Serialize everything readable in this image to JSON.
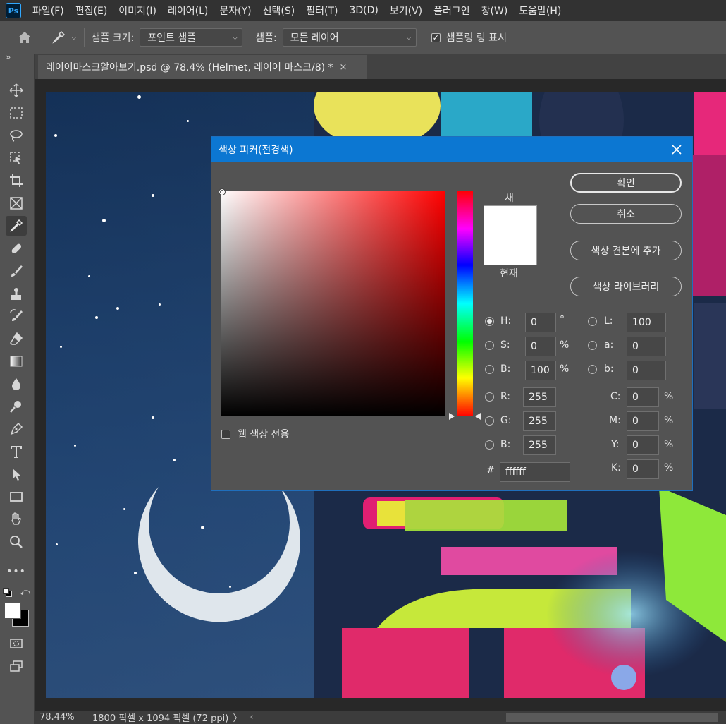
{
  "menubar": {
    "logo": "Ps",
    "items": [
      "파일(F)",
      "편집(E)",
      "이미지(I)",
      "레이어(L)",
      "문자(Y)",
      "선택(S)",
      "필터(T)",
      "3D(D)",
      "보기(V)",
      "플러그인",
      "창(W)",
      "도움말(H)"
    ]
  },
  "options": {
    "sample_size_label": "샘플 크기:",
    "sample_size_value": "포인트 샘플",
    "sample_label": "샘플:",
    "sample_value": "모든 레이어",
    "show_ring_label": "샘플링 링 표시",
    "show_ring_checked": true
  },
  "document_tab": {
    "title": "레이어마스크알아보기.psd @ 78.4% (Helmet, 레이어 마스크/8) *",
    "close": "×"
  },
  "toolbar": {
    "collapse": "»",
    "tools": [
      "move-tool",
      "marquee-tool",
      "lasso-tool",
      "object-select-tool",
      "crop-tool",
      "frame-tool",
      "eyedropper-tool",
      "healing-tool",
      "brush-tool",
      "stamp-tool",
      "history-brush-tool",
      "eraser-tool",
      "gradient-tool",
      "blur-tool",
      "dodge-tool",
      "pen-tool",
      "type-tool",
      "path-select-tool",
      "rectangle-tool",
      "hand-tool",
      "zoom-tool",
      "more-tools"
    ],
    "active_tool": "eyedropper-tool",
    "more": "•••",
    "foreground_color": "#ffffff",
    "background_color": "#000000"
  },
  "status": {
    "zoom": "78.44%",
    "doc_info": "1800 픽셀 x 1094 픽셀 (72 ppi)",
    "arrow": "〉",
    "scroll_left": "‹"
  },
  "color_picker": {
    "title": "색상 피커(전경색)",
    "new_label": "새",
    "current_label": "현재",
    "new_color": "#ffffff",
    "current_color": "#ffffff",
    "web_colors_label": "웹 색상 전용",
    "web_colors_checked": false,
    "buttons": {
      "ok": "확인",
      "cancel": "취소",
      "add_to_swatches": "색상 견본에 추가",
      "color_libraries": "색상 라이브러리"
    },
    "hsb": {
      "h_label": "H:",
      "h_value": "0",
      "h_unit": "°",
      "s_label": "S:",
      "s_value": "0",
      "s_unit": "%",
      "b_label": "B:",
      "b_value": "100",
      "b_unit": "%"
    },
    "lab": {
      "l_label": "L:",
      "l_value": "100",
      "a_label": "a:",
      "a_value": "0",
      "b_label": "b:",
      "b_value": "0"
    },
    "rgb": {
      "r_label": "R:",
      "r_value": "255",
      "g_label": "G:",
      "g_value": "255",
      "b_label": "B:",
      "b_value": "255"
    },
    "cmyk": {
      "c_label": "C:",
      "c_value": "0",
      "m_label": "M:",
      "m_value": "0",
      "y_label": "Y:",
      "y_value": "0",
      "k_label": "K:",
      "k_value": "0",
      "unit": "%"
    },
    "hex_label": "#",
    "hex_value": "ffffff",
    "selected_mode": "H",
    "hue_value": 0
  }
}
